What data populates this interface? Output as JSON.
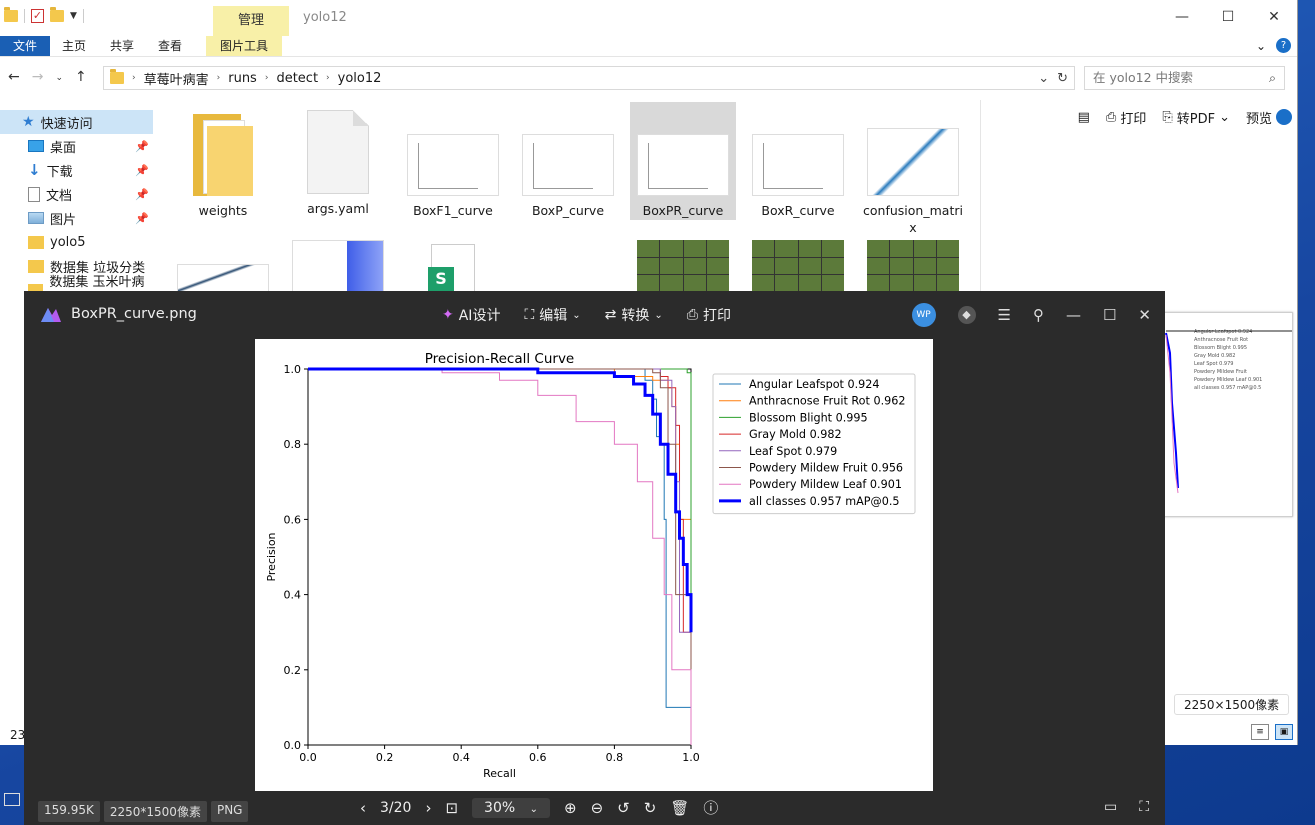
{
  "explorer": {
    "window_title": "yolo12",
    "context_tab_header": "管理",
    "ribbon_tabs": [
      "文件",
      "主页",
      "共享",
      "查看"
    ],
    "context_tab": "图片工具",
    "breadcrumb": [
      "草莓叶病害",
      "runs",
      "detect",
      "yolo12"
    ],
    "search_placeholder": "在 yolo12 中搜索",
    "nav_items": [
      {
        "label": "快速访问"
      },
      {
        "label": "桌面"
      },
      {
        "label": "下载"
      },
      {
        "label": "文档"
      },
      {
        "label": "图片"
      },
      {
        "label": "yolo5"
      },
      {
        "label": "数据集 垃圾分类"
      },
      {
        "label": "数据集 玉米叶病虫"
      }
    ],
    "files": [
      {
        "label": "weights"
      },
      {
        "label": "args.yaml"
      },
      {
        "label": "BoxF1_curve"
      },
      {
        "label": "BoxP_curve"
      },
      {
        "label": "BoxPR_curve"
      },
      {
        "label": "BoxR_curve"
      },
      {
        "label": "confusion_matrix"
      }
    ],
    "preview_toolbar": {
      "print": "打印",
      "to_pdf": "转PDF",
      "preview": "预览"
    },
    "preview_dims": "2250×1500像素",
    "item_count": "23"
  },
  "viewer": {
    "file_name": "BoxPR_curve.png",
    "tools": [
      "AI设计",
      "编辑",
      "转换",
      "打印"
    ],
    "avatar_text": "WP",
    "file_size": "159.95K",
    "dims": "2250*1500像素",
    "format": "PNG",
    "page": "3/20",
    "zoom": "30%"
  },
  "chart_data": {
    "type": "line",
    "title": "Precision-Recall Curve",
    "xlabel": "Recall",
    "ylabel": "Precision",
    "xlim": [
      0,
      1
    ],
    "ylim": [
      0,
      1
    ],
    "xticks": [
      "0.0",
      "0.2",
      "0.4",
      "0.6",
      "0.8",
      "1.0"
    ],
    "yticks": [
      "0.0",
      "0.2",
      "0.4",
      "0.6",
      "0.8",
      "1.0"
    ],
    "legend_position": "top-right-outside",
    "series": [
      {
        "name": "Angular Leafspot 0.924",
        "color": "#1f77b4",
        "width": 1,
        "x": [
          0,
          0.6,
          0.88,
          0.9,
          0.91,
          0.92,
          0.93,
          0.935,
          1.0
        ],
        "y": [
          1,
          1,
          0.97,
          0.92,
          0.82,
          0.8,
          0.6,
          0.1,
          0
        ]
      },
      {
        "name": "Anthracnose Fruit Rot 0.962",
        "color": "#ff7f0e",
        "width": 1,
        "x": [
          0,
          0.8,
          0.9,
          0.94,
          0.95,
          0.96,
          0.97,
          1.0,
          1.0
        ],
        "y": [
          1,
          0.98,
          0.97,
          0.95,
          0.9,
          0.8,
          0.6,
          0.6,
          0
        ]
      },
      {
        "name": "Blossom Blight 0.995",
        "color": "#2ca02c",
        "width": 1,
        "x": [
          0,
          0.98,
          0.99,
          1.0,
          1.0
        ],
        "y": [
          1,
          1,
          0.99,
          0.98,
          0
        ]
      },
      {
        "name": "Gray Mold 0.982",
        "color": "#d62728",
        "width": 1,
        "x": [
          0,
          0.9,
          0.92,
          0.94,
          0.96,
          0.97,
          0.98,
          1.0
        ],
        "y": [
          1,
          1,
          0.98,
          0.95,
          0.85,
          0.6,
          0.3,
          0
        ]
      },
      {
        "name": "Leaf Spot 0.979",
        "color": "#9467bd",
        "width": 1,
        "x": [
          0,
          0.85,
          0.92,
          0.95,
          0.96,
          0.97,
          1.0
        ],
        "y": [
          1,
          1,
          0.97,
          0.9,
          0.7,
          0.3,
          0
        ]
      },
      {
        "name": "Powdery Mildew Fruit 0.956",
        "color": "#8c564b",
        "width": 1,
        "x": [
          0,
          0.85,
          0.9,
          0.92,
          0.94,
          0.96,
          1.0
        ],
        "y": [
          1,
          1,
          0.99,
          0.95,
          0.8,
          0.4,
          0
        ]
      },
      {
        "name": "Powdery Mildew Leaf 0.901",
        "color": "#e377c2",
        "width": 1,
        "x": [
          0,
          0.35,
          0.5,
          0.6,
          0.7,
          0.8,
          0.86,
          0.9,
          0.93,
          0.95,
          1.0
        ],
        "y": [
          1,
          0.99,
          0.97,
          0.93,
          0.86,
          0.8,
          0.7,
          0.55,
          0.4,
          0.2,
          0
        ]
      },
      {
        "name": "all classes 0.957 mAP@0.5",
        "color": "#0000ff",
        "width": 3,
        "x": [
          0,
          0.6,
          0.8,
          0.85,
          0.88,
          0.9,
          0.92,
          0.94,
          0.96,
          0.97,
          0.98,
          0.99,
          1.0
        ],
        "y": [
          1,
          0.99,
          0.98,
          0.96,
          0.93,
          0.88,
          0.8,
          0.72,
          0.62,
          0.55,
          0.48,
          0.4,
          0.3
        ]
      }
    ]
  }
}
